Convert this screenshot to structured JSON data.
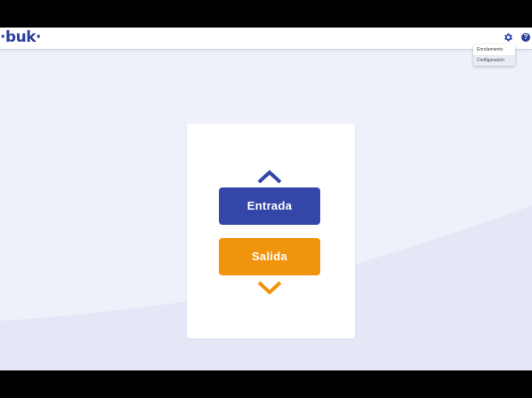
{
  "header": {
    "logo_text": "·buk·"
  },
  "menu": {
    "items": [
      {
        "label": "Enrolamiento"
      },
      {
        "label": "Configuración"
      }
    ]
  },
  "attendance": {
    "entrada_label": "Entrada",
    "salida_label": "Salida"
  },
  "colors": {
    "entrada": "#3447a8",
    "salida": "#f0930d",
    "brand": "#2c3f9c"
  },
  "icons": {
    "settings": "gear-icon",
    "help": "help-icon",
    "up": "chevron-up-icon",
    "down": "chevron-down-icon"
  }
}
